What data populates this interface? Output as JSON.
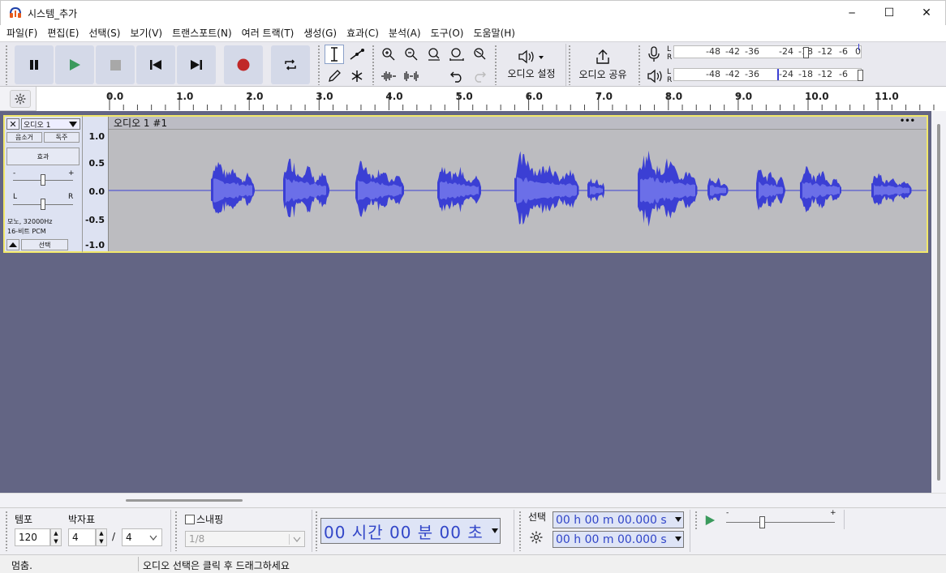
{
  "window": {
    "title": "시스템_추가",
    "minimize": "─",
    "maximize": "☐",
    "close": "✕"
  },
  "menu": [
    "파일(F)",
    "편집(E)",
    "선택(S)",
    "보기(V)",
    "트랜스포트(N)",
    "여러 트랙(T)",
    "생성(G)",
    "효과(C)",
    "분석(A)",
    "도구(O)",
    "도움말(H)"
  ],
  "toolbar": {
    "audio_setup": "오디오 설정",
    "audio_share": "오디오 공유",
    "meter_labels": [
      "-48",
      "-42",
      "-36",
      "-24",
      "-18",
      "-12",
      "-6",
      "0"
    ],
    "meter_L": "L",
    "meter_R": "R"
  },
  "ruler": {
    "labels": [
      "0.0",
      "1.0",
      "2.0",
      "3.0",
      "4.0",
      "5.0",
      "6.0",
      "7.0",
      "8.0",
      "9.0",
      "10.0",
      "11.0"
    ]
  },
  "track": {
    "name": "오디오 1",
    "mute": "음소거",
    "solo": "독주",
    "effects": "효과",
    "gain_minus": "-",
    "gain_plus": "+",
    "pan_left": "L",
    "pan_right": "R",
    "info_line1": "모노, 32000Hz",
    "info_line2": "16-비트 PCM",
    "select": "선택",
    "clip_name": "오디오 1 #1",
    "clip_menu": "•••",
    "scale": [
      "1.0",
      "0.5",
      "0.0",
      "-0.5",
      "-1.0"
    ]
  },
  "bottom": {
    "tempo_label": "템포",
    "tempo_value": "120",
    "time_sig_label": "박자표",
    "time_sig_num": "4",
    "time_sig_sep": "/",
    "time_sig_den": "4",
    "snap_label": "스내핑",
    "snap_value": "1/8",
    "time_display": "00 시간 00 분 00 초",
    "selection_label": "선택",
    "sel_start": "00 h 00 m 00.000 s",
    "sel_end": "00 h 00 m 00.000 s",
    "speed_minus": "-",
    "speed_plus": "+"
  },
  "status": {
    "state": "멈춤.",
    "hint": "오디오 선택은 클릭 후 드래그하세요"
  },
  "colors": {
    "accent_blue": "#3b3fd4",
    "track_bg": "#636584",
    "record_red": "#c02828",
    "play_green": "#3a9a5c"
  }
}
